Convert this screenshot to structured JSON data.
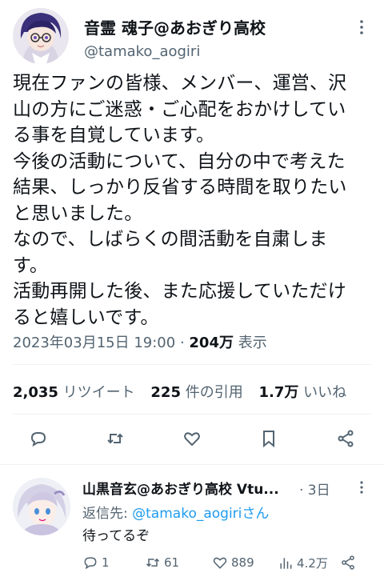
{
  "tweet": {
    "display_name": "音霊 魂子@あおぎり高校",
    "handle": "@tamako_aogiri",
    "text": "現在ファンの皆様、メンバー、運営、沢\n山の方にご迷惑・ご心配をおかけしてい\nる事を自覚しています。\n今後の活動について、自分の中で考えた\n結果、しっかり反省する時間を取りたい\nと思いました。\nなので、しばらくの間活動を自粛しま\nす。\n活動再開した後、また応援していただけ\nると嬉しいです。",
    "timestamp": "2023年03月15日 19:00",
    "separator": " · ",
    "views_count": "204万",
    "views_label": " 表示"
  },
  "stats": {
    "retweets_count": "2,035",
    "retweets_label": " リツイート",
    "quotes_count": "225",
    "quotes_label": " 件の引用",
    "likes_count": "1.7万",
    "likes_label": " いいね"
  },
  "actions": {
    "icons": [
      "reply-icon",
      "retweet-icon",
      "like-icon",
      "bookmark-icon",
      "share-icon"
    ]
  },
  "reply": {
    "display_name": "山黒音玄@あおぎり高校 Vtu...",
    "time": "· 3日",
    "reply_to_prefix": "返信先: ",
    "reply_to_mention": "@tamako_aogiri",
    "reply_to_suffix": "さん",
    "text": "待ってるぞ",
    "replies": "1",
    "retweets": "61",
    "likes": "889",
    "views": "4.2万"
  },
  "colors": {
    "text": "#0f1419",
    "secondary": "#536471",
    "link": "#1d9bf0",
    "divider": "#eff3f4"
  }
}
